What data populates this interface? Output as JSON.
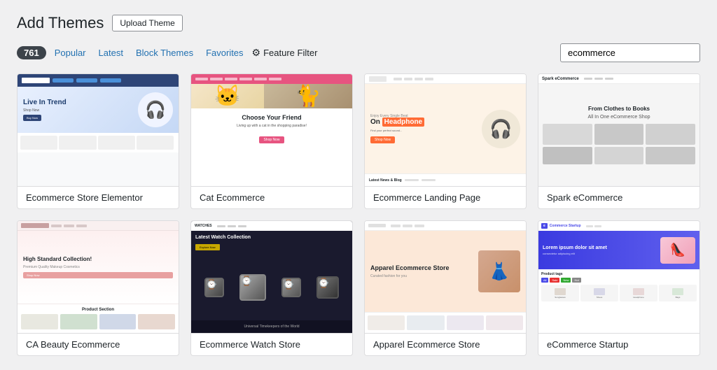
{
  "page": {
    "title": "Add Themes",
    "upload_button": "Upload Theme"
  },
  "nav": {
    "count": "761",
    "links": [
      {
        "label": "Popular",
        "id": "popular"
      },
      {
        "label": "Latest",
        "id": "latest"
      },
      {
        "label": "Block Themes",
        "id": "block-themes"
      },
      {
        "label": "Favorites",
        "id": "favorites"
      }
    ],
    "feature_filter": "Feature Filter",
    "search_placeholder": "ecommerce",
    "search_value": "ecommerce"
  },
  "themes": [
    {
      "id": "ecommerce-store-elementor",
      "name": "Ecommerce Store Elementor",
      "preview_type": "1"
    },
    {
      "id": "cat-ecommerce",
      "name": "Cat Ecommerce",
      "preview_type": "2"
    },
    {
      "id": "ecommerce-landing-page",
      "name": "Ecommerce Landing Page",
      "preview_type": "3"
    },
    {
      "id": "spark-ecommerce",
      "name": "Spark eCommerce",
      "preview_type": "4"
    },
    {
      "id": "ca-beauty-ecommerce",
      "name": "CA Beauty Ecommerce",
      "preview_type": "5"
    },
    {
      "id": "ecommerce-watch-store",
      "name": "Ecommerce Watch Store",
      "preview_type": "6"
    },
    {
      "id": "apparel-ecommerce-store",
      "name": "Apparel Ecommerce Store",
      "preview_type": "7"
    },
    {
      "id": "ecommerce-startup",
      "name": "eCommerce Startup",
      "preview_type": "8"
    }
  ],
  "colors": {
    "accent": "#2271b1",
    "brand_pink": "#e75480",
    "brand_orange": "#ff6b35",
    "brand_blue": "#2E4577"
  }
}
